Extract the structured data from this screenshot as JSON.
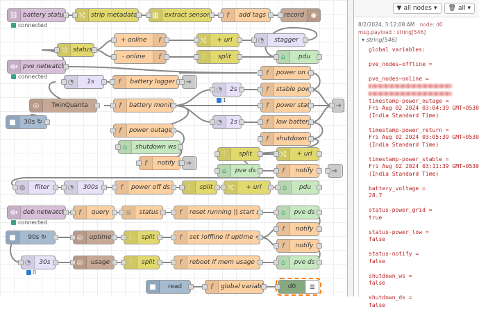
{
  "flow": {
    "row1": {
      "battery_status": "battery status",
      "battery_status_state": "connected",
      "strip_metadata": "strip metadata",
      "extract_sensor": "extract sensor",
      "add_tags": "add tags",
      "record": "record"
    },
    "row2": {
      "status": "status",
      "online": "+ online",
      "offline": "- online",
      "url": "+ url",
      "split": "split",
      "stagger": "stagger",
      "pdu": "pdu"
    },
    "row3": {
      "pve_netwatch": "pve netwatch",
      "pve_netwatch_state": "connected",
      "power_on_ds": "power on ds"
    },
    "row4": {
      "interval_1s": "1s",
      "battery_logger": "battery logger",
      "interval_2s": "2s",
      "stable_power": "stable power",
      "badge_1": "1"
    },
    "row5": {
      "twinquanta": "TwinQuanta",
      "battery_monitor": "battery monitor",
      "power_status": "power status"
    },
    "row6": {
      "inject_30s": "30s ↻",
      "interval_1s_b": "1s",
      "low_battery": "low battery"
    },
    "row7": {
      "power_outage": "power outage",
      "shutdown_ds": "shutdown ds"
    },
    "row8": {
      "shutdown_ws": "shutdown ws",
      "split": "split",
      "url": "+ url"
    },
    "row9": {
      "notify": "notify",
      "pve_ds": "pve ds",
      "notify_b": "notify"
    },
    "row10": {
      "filter": "filter",
      "interval_300s": "300s",
      "power_off_ds": "power off ds",
      "split": "split",
      "url": "+ url",
      "pdu": "pdu"
    },
    "row11": {
      "deb_netwatch": "deb netwatch",
      "deb_netwatch_state": "connected",
      "query": "query",
      "status": "status",
      "reset_running": "reset running || start stopped",
      "pve_ds": "pve ds"
    },
    "row12": {
      "notify": "notify"
    },
    "row13": {
      "inject_90s": "90s ↻",
      "uptime": "uptime",
      "split": "split",
      "set_offline": "set !offline if uptime < 181s",
      "notify": "notify"
    },
    "row14": {
      "interval_30s": "30s",
      "badge_0": "0",
      "usage": "usage",
      "split": "split",
      "reboot": "reboot if mem usage > 99%",
      "pve_ds": "pve ds"
    },
    "row15": {
      "read": "read",
      "global_variables": "global variables",
      "d0": "d0"
    }
  },
  "sidebar": {
    "filter_nodes": "all nodes",
    "filter_all": "all",
    "timestamp": "8/2/2024, 3:12:08 AM",
    "node": "node: d0",
    "msg_type": "msg.payload : string[546]",
    "string_header": "string[546]",
    "payload_lines": [
      "global variables:",
      "",
      "pve_nodes~offline =",
      "",
      "pve_nodes~online =",
      "",
      "",
      "timestamp-power_outage =",
      "Fri Aug 02 2024 03:04:39 GMT+0530",
      "(India Standard Time)",
      "",
      "timestamp-power_return =",
      "Fri Aug 02 2024 03:05:39 GMT+0530",
      "(India Standard Time)",
      "",
      "timestamp-power_stable =",
      "Fri Aug 02 2024 03:11:39 GMT+0530",
      "(India Standard Time)",
      "",
      "battery_voltage =",
      "28.7",
      "",
      "status-power_grid =",
      "true",
      "",
      "status-power_low =",
      "false",
      "",
      "status-notify =",
      "false",
      "",
      "shutdown_ws =",
      "false",
      "",
      "shutdown_ds =",
      "false"
    ]
  },
  "colors": {
    "function": "#fdd0a2",
    "inject": "#a6bbcf",
    "delay": "#e6e0f8",
    "split": "#e2d96e",
    "ha": "#c7e9c0",
    "status_green": "#3aa387",
    "badge_blue": "#2f7bd3",
    "msg_red": "#b22222"
  }
}
